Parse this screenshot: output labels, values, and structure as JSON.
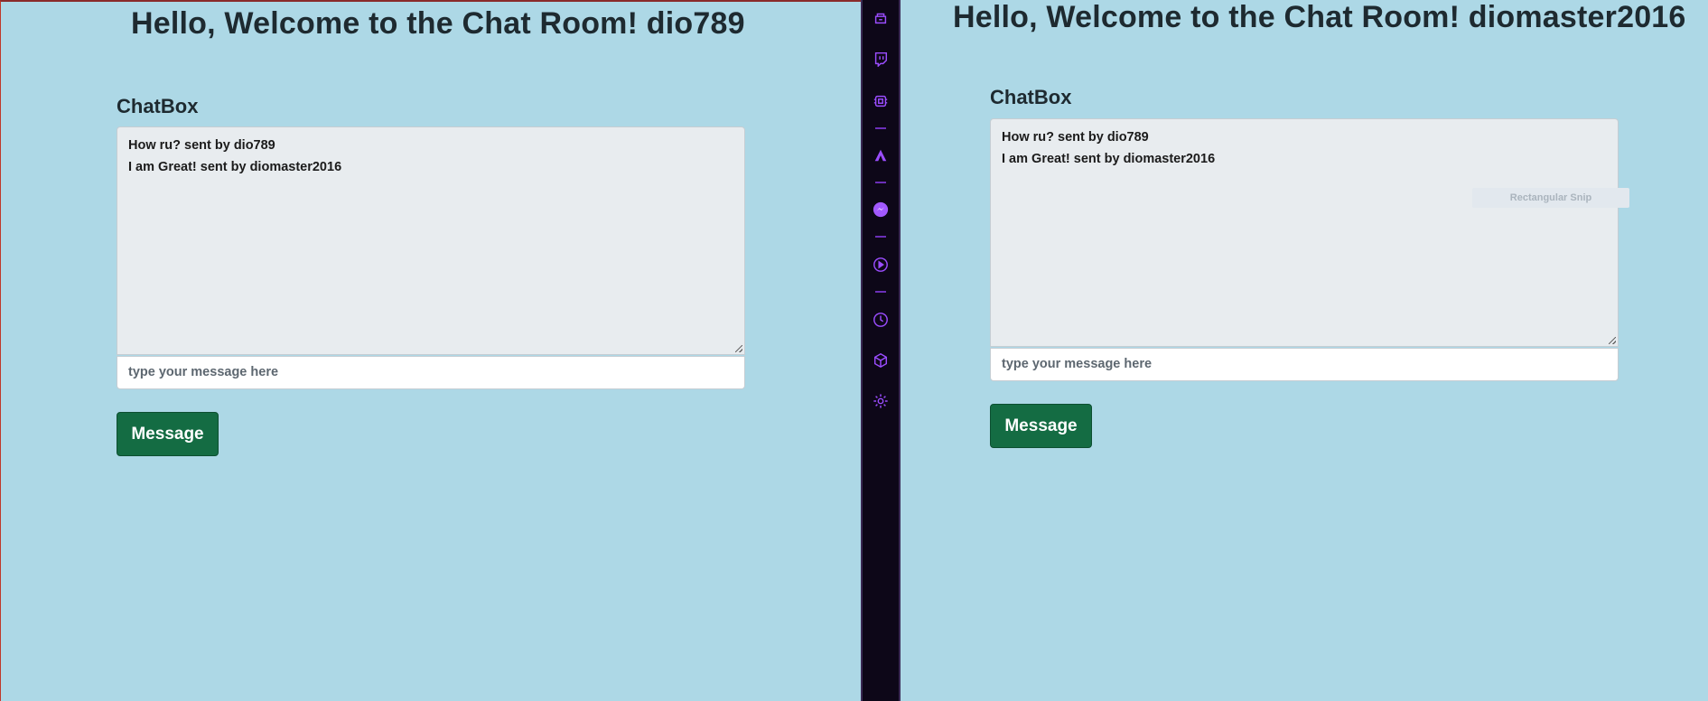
{
  "left_window": {
    "title": "Hello, Welcome to the Chat Room! dio789",
    "chatbox_label": "ChatBox",
    "messages": [
      "How ru? sent by dio789",
      "I am Great! sent by diomaster2016"
    ],
    "input_placeholder": "type your message here",
    "button_label": "Message"
  },
  "right_window": {
    "title": "Hello, Welcome to the Chat Room! diomaster2016",
    "chatbox_label": "ChatBox",
    "messages": [
      "How ru? sent by dio789",
      "I am Great! sent by diomaster2016"
    ],
    "input_placeholder": "type your message here",
    "button_label": "Message",
    "overlay_hint": "Rectangular Snip"
  },
  "sidebar": {
    "icons": [
      "store-icon",
      "twitch-icon",
      "chip-icon",
      "arc-icon",
      "messenger-icon",
      "play-icon",
      "clock-icon",
      "cube-icon",
      "gear-icon"
    ]
  },
  "colors": {
    "page_background": "#add8e6",
    "button_green": "#146c43",
    "chat_area": "#e8ecef",
    "sidebar_background": "#0d0718",
    "sidebar_accent": "#9b4dff"
  }
}
